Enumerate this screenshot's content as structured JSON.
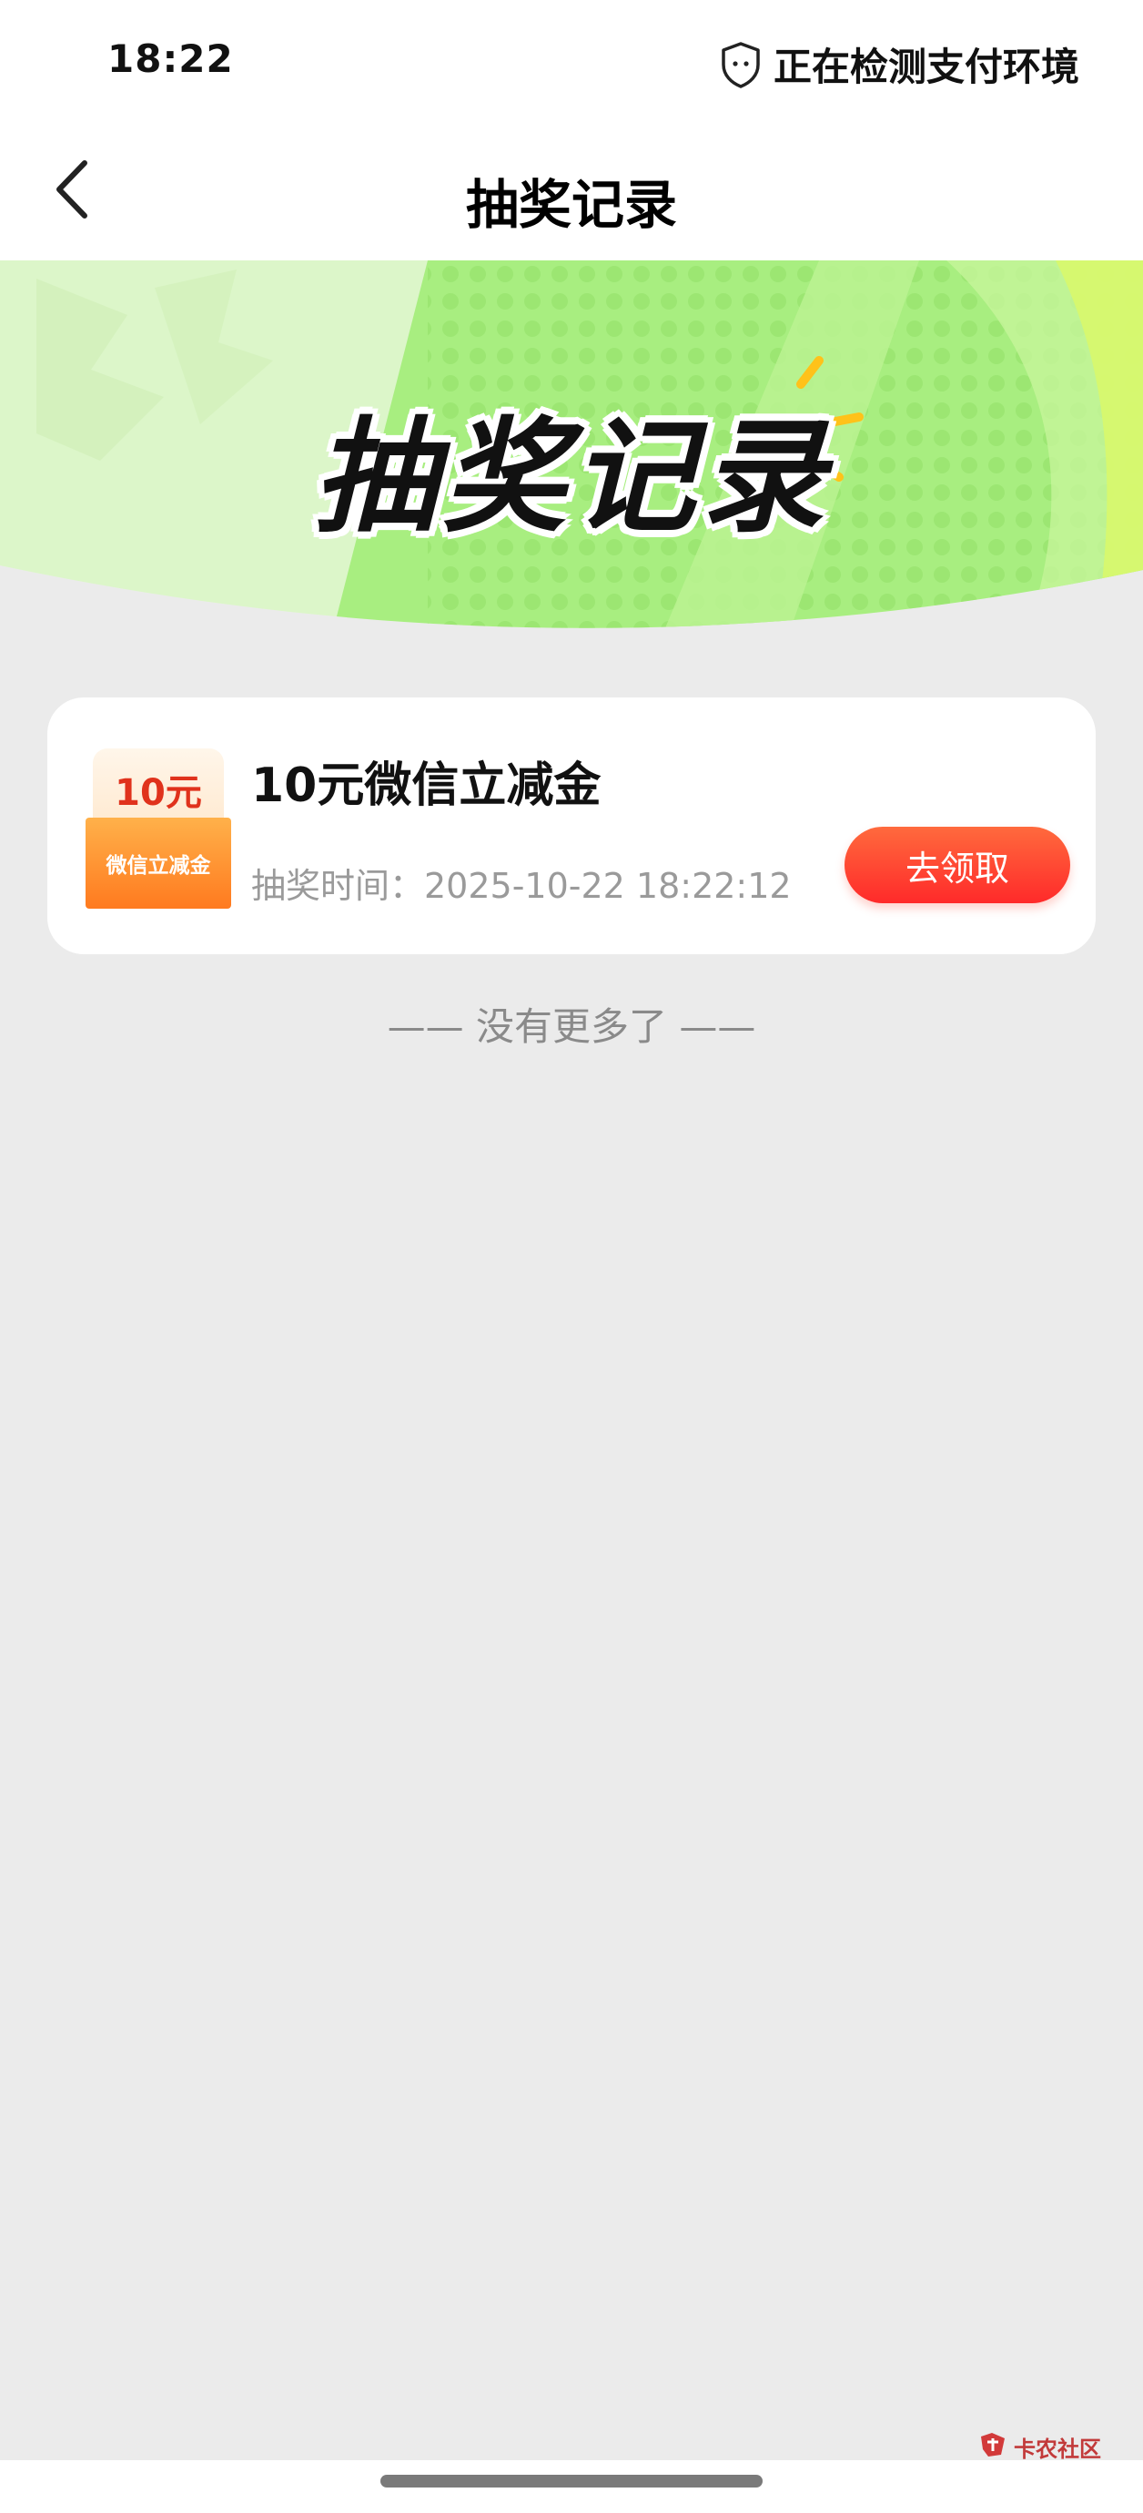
{
  "status_bar": {
    "time": "18:22",
    "status_text": "正在检测支付环境",
    "status_icon": "shield-icon"
  },
  "nav": {
    "back_icon": "chevron-left-icon",
    "title": "抽奖记录"
  },
  "banner": {
    "title": "抽奖记录",
    "colors": {
      "light_green": "#d9f8c4",
      "green": "#9be86f",
      "lime": "#ccf56a",
      "sparkle": "#ffc21a"
    }
  },
  "records": [
    {
      "coupon_amount": "10元",
      "coupon_label": "微信立减金",
      "name": "10元微信立减金",
      "time_label": "抽奖时间：",
      "time_value": "2025-10-22 18:22:12",
      "time_text": "抽奖时间：2025-10-22 18:22:12",
      "action_label": "去领取"
    }
  ],
  "footer": {
    "no_more_text": "—— 没有更多了 ——"
  },
  "watermark": {
    "text": "卡农社区"
  },
  "colors": {
    "page_bg": "#ebebeb",
    "accent_red": "#ff2a2a",
    "accent_orange": "#ff7a1f"
  }
}
